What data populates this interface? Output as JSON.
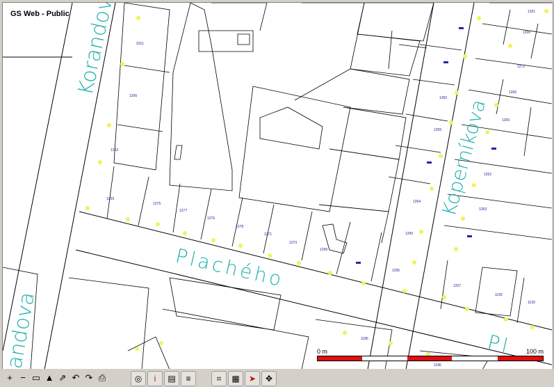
{
  "window": {
    "title": "GS Web - Public"
  },
  "map": {
    "streets": [
      {
        "id": "korandova-1",
        "label": "Korandova"
      },
      {
        "id": "korandova-2",
        "label": "andova"
      },
      {
        "id": "kopernikova",
        "label": "Koperníkova"
      },
      {
        "id": "placheho-1",
        "label": "Plachého"
      },
      {
        "id": "placheho-2",
        "label": "Pl"
      }
    ],
    "parcels": [
      "2311",
      "1256",
      "1253",
      "1259",
      "1275",
      "1277",
      "1276",
      "1278",
      "1271",
      "1273",
      "1299",
      "1295",
      "1290",
      "1264",
      "1255",
      "1260",
      "1262",
      "1263",
      "1265",
      "1266",
      "1272",
      "1200",
      "1201",
      "1207",
      "1192",
      "1193",
      "1185",
      "1186",
      "1187",
      "1188",
      "1232",
      "1243",
      "1237",
      "1057",
      "1054",
      "1202",
      "1279"
    ],
    "colors": {
      "streets": "#22b0b0",
      "parcel_numbers": "#1a1a90",
      "markers": "#f2f25a",
      "scale_bar": "#e01010"
    }
  },
  "scale": {
    "start_label": "0 m",
    "end_label": "100 m"
  },
  "toolbar": {
    "zoom_in": "+",
    "zoom_out": "−",
    "full_extent": "▭",
    "overview": "▲",
    "measure": "⇗",
    "undo": "↶",
    "redo": "↷",
    "print": "⎙",
    "layers": "◎",
    "identify": "i",
    "legend": "▤",
    "info": "≡",
    "select": "⌗",
    "zoom_box": "▦",
    "route": "➤",
    "pan": "✥"
  }
}
